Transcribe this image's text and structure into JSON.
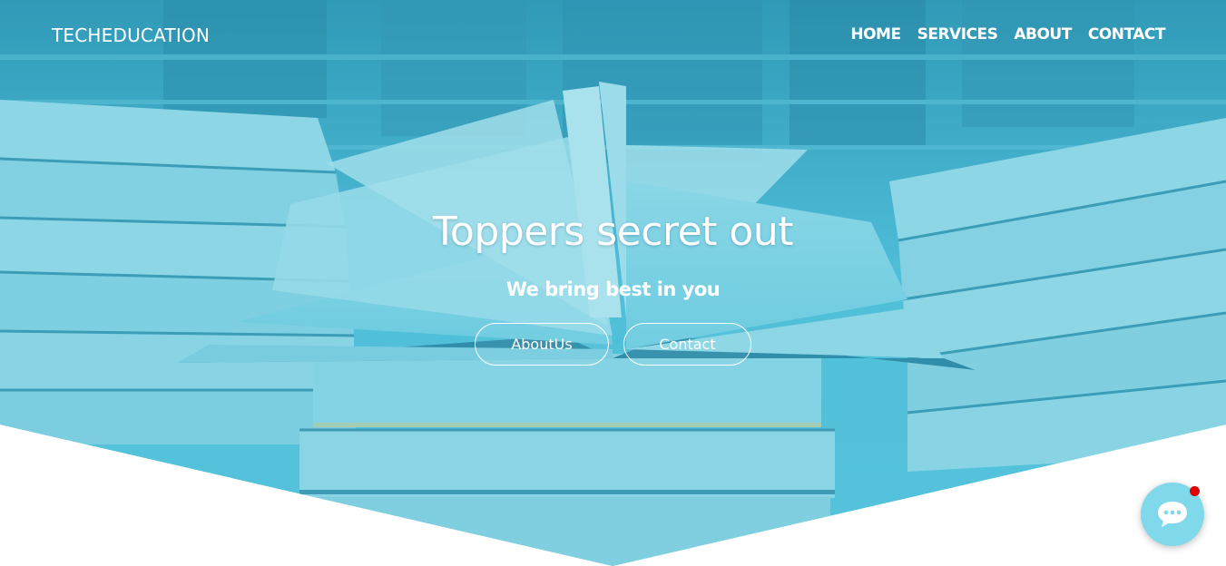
{
  "brand": {
    "name": "TECHEDUCATION"
  },
  "nav": {
    "home": "HOME",
    "services": "SERVICES",
    "about": "ABOUT",
    "contact": "CONTACT"
  },
  "hero": {
    "title": "Toppers secret out",
    "subtitle": "We bring best in you",
    "buttons": {
      "about": "AboutUs",
      "contact": "Contact"
    },
    "background_image": "stacked-books-open-book-icon",
    "overlay_color": "#3fb7d2"
  },
  "chat_widget": {
    "icon": "chat-bubble-icon",
    "badge_color": "#e00000",
    "color": "#7fd9ea"
  }
}
